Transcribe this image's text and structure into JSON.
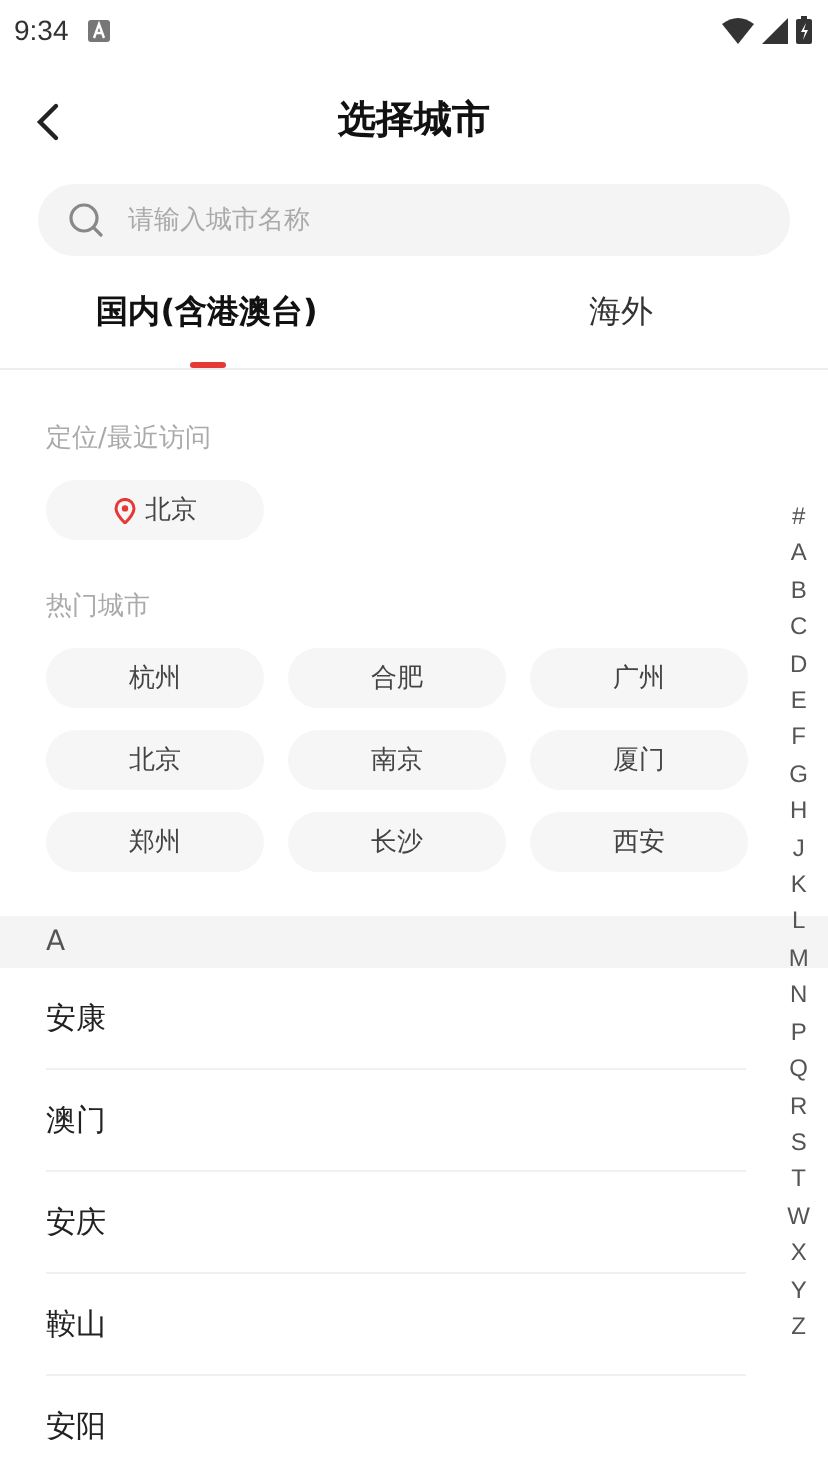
{
  "status_bar": {
    "time": "9:34"
  },
  "header": {
    "title": "选择城市"
  },
  "search": {
    "placeholder": "请输入城市名称"
  },
  "tabs": [
    {
      "label": "国内(含港澳台)",
      "selected": true
    },
    {
      "label": "海外",
      "selected": false
    }
  ],
  "recent": {
    "heading": "定位/最近访问",
    "cities": [
      "北京"
    ]
  },
  "hot": {
    "heading": "热门城市",
    "cities": [
      "杭州",
      "合肥",
      "广州",
      "北京",
      "南京",
      "厦门",
      "郑州",
      "长沙",
      "西安"
    ]
  },
  "sections": [
    {
      "letter": "A",
      "cities": [
        "安康",
        "澳门",
        "安庆",
        "鞍山",
        "安阳"
      ]
    }
  ],
  "index": [
    "#",
    "A",
    "B",
    "C",
    "D",
    "E",
    "F",
    "G",
    "H",
    "J",
    "K",
    "L",
    "M",
    "N",
    "P",
    "Q",
    "R",
    "S",
    "T",
    "W",
    "X",
    "Y",
    "Z"
  ]
}
